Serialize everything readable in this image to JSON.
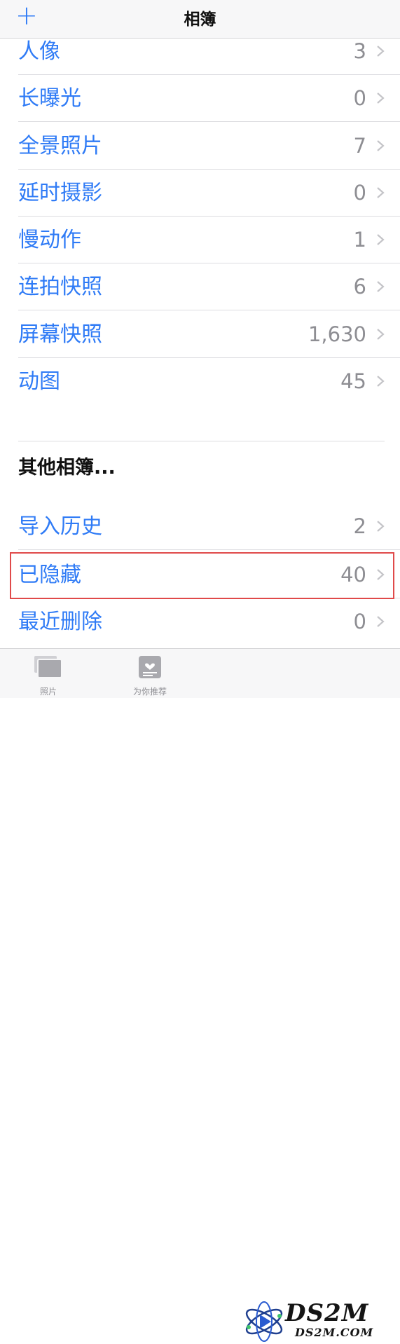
{
  "nav": {
    "add_icon": "+",
    "title": "相簿"
  },
  "albums": [
    {
      "label": "人像",
      "count": "3"
    },
    {
      "label": "长曝光",
      "count": "0"
    },
    {
      "label": "全景照片",
      "count": "7"
    },
    {
      "label": "延时摄影",
      "count": "0"
    },
    {
      "label": "慢动作",
      "count": "1"
    },
    {
      "label": "连拍快照",
      "count": "6"
    },
    {
      "label": "屏幕快照",
      "count": "1,630"
    },
    {
      "label": "动图",
      "count": "45"
    }
  ],
  "other_section": {
    "title": "其他相簿...",
    "items": [
      {
        "label": "导入历史",
        "count": "2"
      },
      {
        "label": "已隐藏",
        "count": "40"
      },
      {
        "label": "最近删除",
        "count": "0"
      }
    ]
  },
  "tabs": [
    {
      "label": "照片",
      "icon": "photos-stack-icon"
    },
    {
      "label": "为你推荐",
      "icon": "for-you-icon"
    }
  ],
  "watermark": {
    "title": "DS2M",
    "sub": "DS2M.COM"
  },
  "colors": {
    "accent": "#2f7bf6",
    "count": "#8e8e93",
    "highlight": "#e04a4a"
  }
}
